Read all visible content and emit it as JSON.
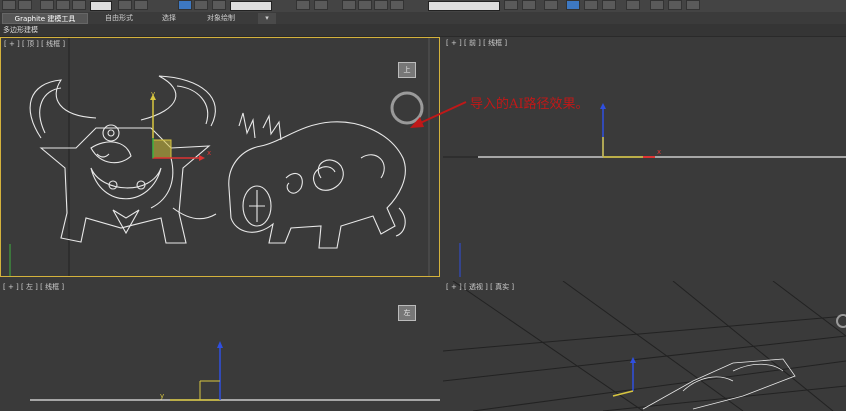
{
  "ribbon": {
    "tabs": [
      {
        "label": "Graphite 建模工具",
        "active": true
      },
      {
        "label": "自由形式",
        "active": false
      },
      {
        "label": "选择",
        "active": false
      },
      {
        "label": "对象绘制",
        "active": false
      }
    ],
    "subpanel_label": "多边形建模"
  },
  "viewports": {
    "top": {
      "label": "[ + ] [ 顶 ] [ 线框 ]",
      "cube_label": "上"
    },
    "front": {
      "label": "[ + ] [ 前 ] [ 线框 ]"
    },
    "left": {
      "label": "[ + ] [ 左 ] [ 线框 ]",
      "cube_label": "左"
    },
    "perspective": {
      "label": "[ + ] [ 透视 ] [ 真实 ]"
    }
  },
  "axes": {
    "x": "x",
    "y": "y"
  },
  "annotation_text": "导入的AI路径效果。",
  "colors": {
    "viewport_bg": "#3a3a3a",
    "active_border": "#d4b23c",
    "annotation": "#c01818",
    "active_tool": "#3d78c2"
  }
}
